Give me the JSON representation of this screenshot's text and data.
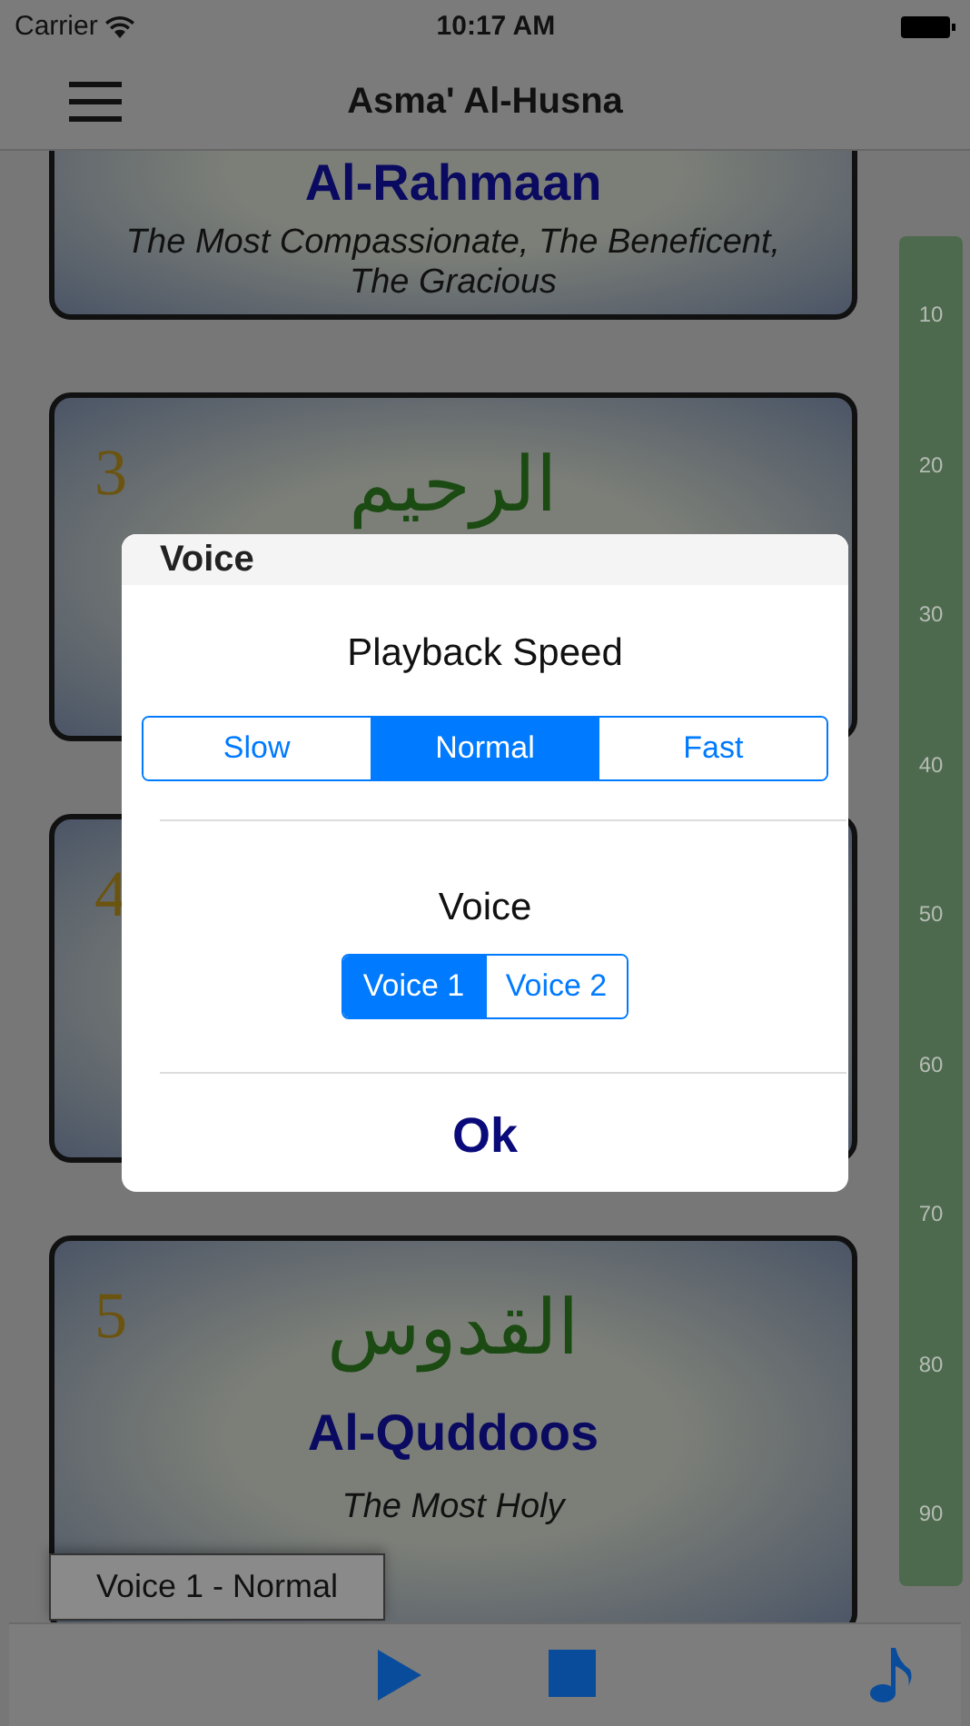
{
  "status_bar": {
    "carrier": "Carrier",
    "time": "10:17 AM"
  },
  "nav_bar": {
    "title": "Asma' Al-Husna"
  },
  "cards": [
    {
      "name": "Al-Rahmaan",
      "meaning": "The Most Compassionate, The Beneficent, The Gracious"
    },
    {
      "number": "3",
      "arabic": "الرحيم"
    },
    {
      "number": "4"
    },
    {
      "number": "5",
      "arabic": "القدوس",
      "name": "Al-Quddoos",
      "meaning": "The Most Holy"
    }
  ],
  "index": [
    "10",
    "20",
    "30",
    "40",
    "50",
    "60",
    "70",
    "80",
    "90"
  ],
  "dialog": {
    "title": "Voice",
    "speed_label": "Playback Speed",
    "speed_options": [
      {
        "label": "Slow",
        "selected": false
      },
      {
        "label": "Normal",
        "selected": true
      },
      {
        "label": "Fast",
        "selected": false
      }
    ],
    "voice_label": "Voice",
    "voice_options": [
      {
        "label": "Voice 1",
        "selected": true
      },
      {
        "label": "Voice 2",
        "selected": false
      }
    ],
    "ok": "Ok"
  },
  "now_playing": "Voice 1 - Normal"
}
